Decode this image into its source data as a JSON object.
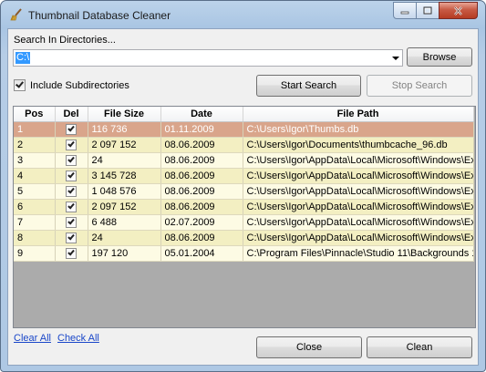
{
  "window": {
    "title": "Thumbnail Database Cleaner",
    "controls": {
      "minimize": "minimize",
      "maximize": "maximize",
      "close": "close"
    }
  },
  "search": {
    "label": "Search In Directories...",
    "path_value": "C:\\",
    "browse_label": "Browse"
  },
  "options": {
    "include_subdirs_label": "Include Subdirectories",
    "include_subdirs_checked": true
  },
  "actions": {
    "start_label": "Start Search",
    "stop_label": "Stop Search",
    "close_label": "Close",
    "clean_label": "Clean"
  },
  "links": {
    "clear_all": "Clear All",
    "check_all": "Check All"
  },
  "table": {
    "columns": [
      "Pos",
      "Del",
      "File Size",
      "Date",
      "File Path"
    ],
    "rows": [
      {
        "pos": "1",
        "del": true,
        "size": "116 736",
        "date": "01.11.2009",
        "path": "C:\\Users\\Igor\\Thumbs.db",
        "selected": true
      },
      {
        "pos": "2",
        "del": true,
        "size": "2 097 152",
        "date": "08.06.2009",
        "path": "C:\\Users\\Igor\\Documents\\thumbcache_96.db"
      },
      {
        "pos": "3",
        "del": true,
        "size": "24",
        "date": "08.06.2009",
        "path": "C:\\Users\\Igor\\AppData\\Local\\Microsoft\\Windows\\Ex..."
      },
      {
        "pos": "4",
        "del": true,
        "size": "3 145 728",
        "date": "08.06.2009",
        "path": "C:\\Users\\Igor\\AppData\\Local\\Microsoft\\Windows\\Ex..."
      },
      {
        "pos": "5",
        "del": true,
        "size": "1 048 576",
        "date": "08.06.2009",
        "path": "C:\\Users\\Igor\\AppData\\Local\\Microsoft\\Windows\\Ex..."
      },
      {
        "pos": "6",
        "del": true,
        "size": "2 097 152",
        "date": "08.06.2009",
        "path": "C:\\Users\\Igor\\AppData\\Local\\Microsoft\\Windows\\Ex..."
      },
      {
        "pos": "7",
        "del": true,
        "size": "6 488",
        "date": "02.07.2009",
        "path": "C:\\Users\\Igor\\AppData\\Local\\Microsoft\\Windows\\Ex..."
      },
      {
        "pos": "8",
        "del": true,
        "size": "24",
        "date": "08.06.2009",
        "path": "C:\\Users\\Igor\\AppData\\Local\\Microsoft\\Windows\\Ex..."
      },
      {
        "pos": "9",
        "del": true,
        "size": "197 120",
        "date": "05.01.2004",
        "path": "C:\\Program Files\\Pinnacle\\Studio 11\\Backgrounds 16..."
      }
    ]
  },
  "colors": {
    "selected_row": "#d9a58b",
    "row_light": "#fdfbe4",
    "row_dark": "#f3efc2",
    "link": "#1a47c9",
    "selection_highlight": "#3399ff"
  }
}
